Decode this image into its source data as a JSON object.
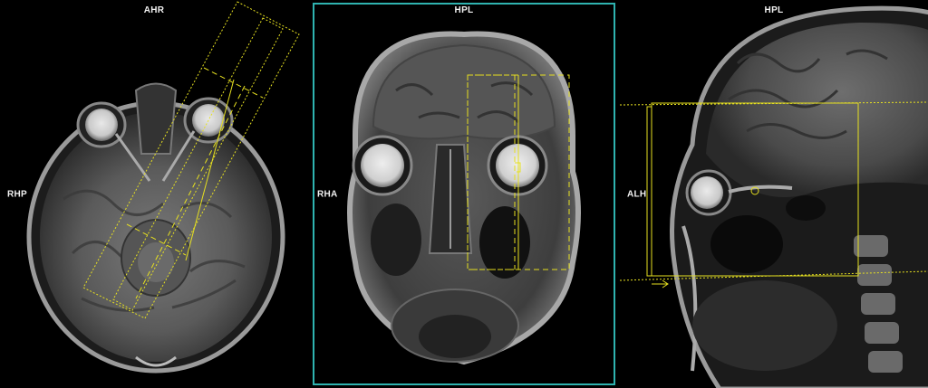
{
  "viewports": {
    "axial": {
      "top_label": "AHR",
      "left_label": "RHP"
    },
    "coronal": {
      "top_label": "HPL",
      "left_label": "RHA"
    },
    "sagittal": {
      "top_label": "HPL",
      "left_label": "ALH"
    }
  },
  "colors": {
    "active_frame": "#2fb3b0",
    "localizer": "#e6e020",
    "orientation_text": "#f2f2f2",
    "background": "#000000"
  }
}
